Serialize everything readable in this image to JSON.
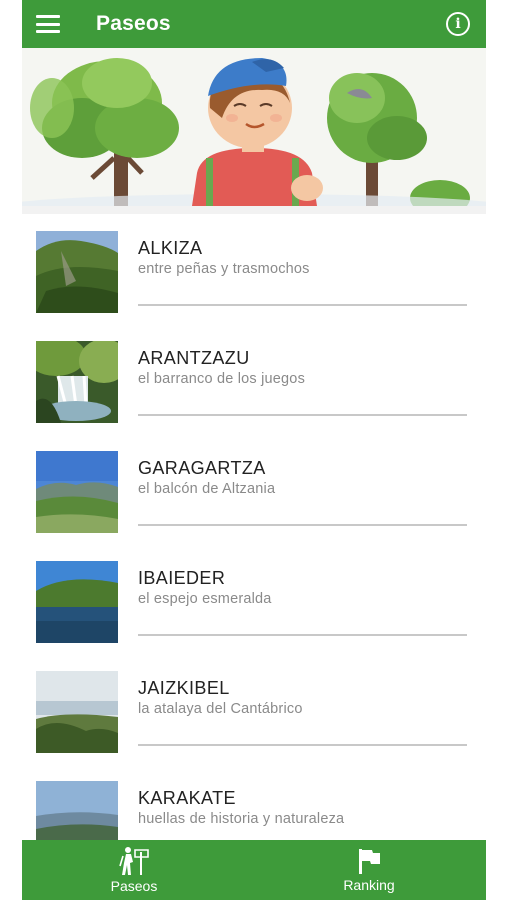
{
  "app_bar": {
    "title": "Paseos",
    "menu_icon": "menu-icon",
    "info_icon": "info-icon"
  },
  "walks": [
    {
      "name": "ALKIZA",
      "subtitle": "entre peñas y trasmochos"
    },
    {
      "name": "ARANTZAZU",
      "subtitle": "el barranco de los juegos"
    },
    {
      "name": "GARAGARTZA",
      "subtitle": "el balcón de Altzania"
    },
    {
      "name": "IBAIEDER",
      "subtitle": "el espejo esmeralda"
    },
    {
      "name": "JAIZKIBEL",
      "subtitle": "la atalaya del Cantábrico"
    },
    {
      "name": "KARAKATE",
      "subtitle": "huellas de historia y naturaleza"
    }
  ],
  "bottom_nav": {
    "paseos_label": "Paseos",
    "ranking_label": "Ranking",
    "paseos_icon": "hiker-signpost-icon",
    "ranking_icon": "flag-icon"
  },
  "colors": {
    "primary": "#3e9b3a",
    "title_text": "#222222",
    "subtitle_text": "#8a8a8a",
    "divider": "#c8c8c8"
  }
}
